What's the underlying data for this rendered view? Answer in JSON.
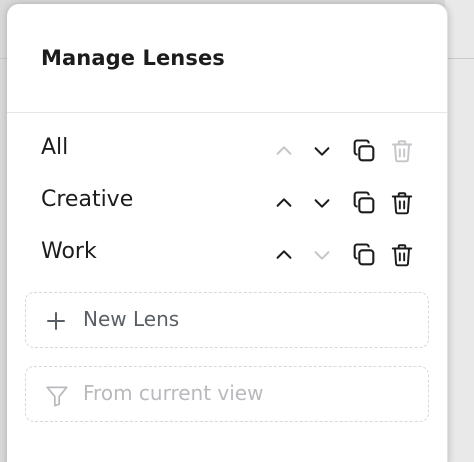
{
  "dialog": {
    "title": "Manage Lenses"
  },
  "lenses": [
    {
      "name": "All",
      "can_move_up": false,
      "can_move_down": true,
      "can_delete": false
    },
    {
      "name": "Creative",
      "can_move_up": true,
      "can_move_down": true,
      "can_delete": true
    },
    {
      "name": "Work",
      "can_move_up": true,
      "can_move_down": false,
      "can_delete": true
    }
  ],
  "actions": {
    "new_lens_label": "New Lens",
    "new_lens_icon": "plus-icon",
    "from_current_view_label": "From current view",
    "from_current_view_icon": "filter-icon",
    "from_current_view_enabled": false
  },
  "colors": {
    "enabled_icon": "#1c1c1c",
    "disabled_icon": "#c4c6c9"
  }
}
